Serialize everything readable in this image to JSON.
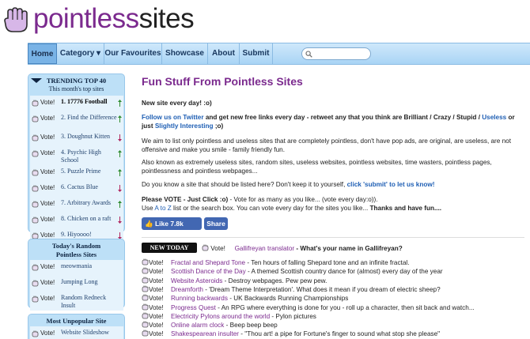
{
  "logo": {
    "part1": "pointless",
    "part2": "sites"
  },
  "nav": {
    "items": [
      "Home",
      "Category ▾",
      "Our Favourites",
      "Showcase",
      "About",
      "Submit"
    ],
    "search_value": ""
  },
  "trending": {
    "title": "TRENDING TOP 40",
    "subtitle": "This month's top sites",
    "items": [
      {
        "vote": "Vote!",
        "text": "1. 17776 Football",
        "bold": true,
        "dir": "up"
      },
      {
        "vote": "Vote!",
        "text": "2. Find the Difference",
        "bold": false,
        "dir": "up"
      },
      {
        "vote": "Vote!",
        "text": "3. Doughnut Kitten",
        "bold": false,
        "dir": "down"
      },
      {
        "vote": "Vote!",
        "text": "4. Psychic High School",
        "bold": false,
        "dir": "up"
      },
      {
        "vote": "Vote!",
        "text": "5. Puzzle Prime",
        "bold": false,
        "dir": "up"
      },
      {
        "vote": "Vote!",
        "text": "6. Cactus Blue",
        "bold": false,
        "dir": "down"
      },
      {
        "vote": "Vote!",
        "text": "7. Arbitrary Awards",
        "bold": false,
        "dir": "up"
      },
      {
        "vote": "Vote!",
        "text": "8. Chicken on a raft",
        "bold": false,
        "dir": "down"
      },
      {
        "vote": "Vote!",
        "text": "9. Hiyoooo!",
        "bold": false,
        "dir": "down"
      },
      {
        "vote": "Vote!",
        "text": "10. Drama Button",
        "bold": false,
        "dir": "down"
      }
    ]
  },
  "random": {
    "title": "Today's Random Pointless Sites",
    "items": [
      {
        "vote": "Vote!",
        "text": "meowmania"
      },
      {
        "vote": "Vote!",
        "text": "Jumping Long"
      },
      {
        "vote": "Vote!",
        "text": "Random Redneck Insult"
      }
    ]
  },
  "unpopular": {
    "title": "Most Unpopular Site",
    "items": [
      {
        "vote": "Vote!",
        "text": "Website Slideshow"
      }
    ]
  },
  "main": {
    "heading": "Fun Stuff From Pointless Sites",
    "tagline": "New site every day! :o)",
    "follow_pre": "Follow us on Twitter",
    "follow_mid": " and get new free links every day - retweet any that you think are Brilliant / Crazy / Stupid / ",
    "follow_useless": "Useless",
    "follow_or": " or just ",
    "follow_slightly": "Slightly Interesting",
    "follow_end": " ;o)",
    "para1": "We aim to list only pointless and useless sites that are completely pointless, don't have pop ads, are original, are useless, are not offensive and make you smile - family friendly fun.",
    "para2": "Also known as extremely useless sites, random sites, useless websites, pointless websites, time wasters, pointless pages, pointlessness and pointless webpages...",
    "para3_pre": "Do you know a site that should be listed here? Don't keep it to yourself, ",
    "para3_link": "click 'submit' to let us know!",
    "vote_bold": "Please VOTE - Just Click :o)",
    "vote_rest": " - Vote for as many as you like... (vote every day:o)).",
    "use_pre": "Use ",
    "use_az": "A to Z",
    "use_mid": " list or the search box. You can vote every day for the sites you like... ",
    "use_bold": "Thanks and have fun....",
    "fb_like": "Like 7.8k",
    "fb_share": "Share",
    "new_today_badge": "NEW TODAY",
    "new_today": {
      "vote": "Vote!",
      "title": "Gallifreyan translator",
      "desc": " - What's your name in Gallifreyan?"
    },
    "list": [
      {
        "vote": "Vote!",
        "title": "Fractal and Shepard Tone",
        "desc": " - Ten hours of falling Shepard tone and an infinite fractal."
      },
      {
        "vote": "Vote!",
        "title": "Scottish Dance of the Day",
        "desc": " - A themed Scottish country dance for (almost) every day of the year"
      },
      {
        "vote": "Vote!",
        "title": "Website Asteroids",
        "desc": " - Destroy webpages. Pew pew pew."
      },
      {
        "vote": "Vote!",
        "title": "Dreamforth",
        "desc": " - 'Dream Theme Interpretation'. What does it mean if you dream of electric sheep?"
      },
      {
        "vote": "Vote!",
        "title": "Running backwards",
        "desc": " - UK Backwards Running Championships"
      },
      {
        "vote": "Vote!",
        "title": "Progress Quest",
        "desc": " - An RPG where everything is done for you - roll up a character, then sit back and watch..."
      },
      {
        "vote": "Vote!",
        "title": "Electricity Pylons around the world",
        "desc": " - Pylon pictures"
      },
      {
        "vote": "Vote!",
        "title": "Online alarm clock",
        "desc": " - Beep beep beep"
      },
      {
        "vote": "Vote!",
        "title": "Shakespearean insulter",
        "desc": " - \"Thou art! a pipe for Fortune's finger to sound what stop she please\""
      }
    ]
  }
}
